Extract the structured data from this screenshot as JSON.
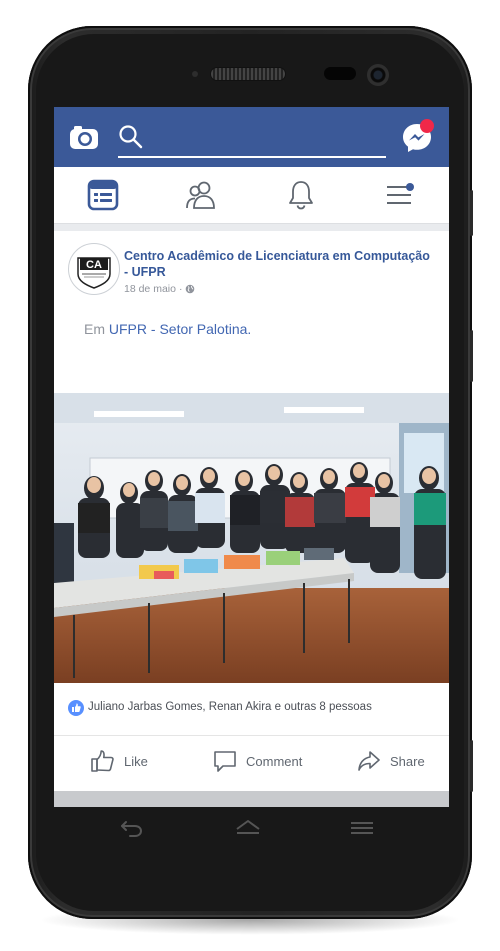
{
  "post": {
    "page_name": "Centro Acadêmico de Licenciatura em Computação - UFPR",
    "date": "18 de maio",
    "text_prefix": "Em ",
    "location": "UFPR - Setor Palotina.",
    "reactions": "Juliano Jarbas Gomes, Renan Akira e outras 8 pessoas"
  },
  "avatar": {
    "logo_text": "CA"
  },
  "actions": {
    "like": "Like",
    "comment": "Comment",
    "share": "Share"
  },
  "colors": {
    "brand": "#3b5998",
    "link": "#4267b2",
    "notification": "#f02849",
    "like_badge": "#5890ff"
  },
  "icons": [
    "camera-icon",
    "search-icon",
    "messenger-icon",
    "news-feed-icon",
    "friends-icon",
    "notifications-icon",
    "menu-icon",
    "globe-icon",
    "like-icon",
    "comment-icon",
    "share-icon",
    "back-icon",
    "home-icon",
    "recent-apps-icon"
  ]
}
